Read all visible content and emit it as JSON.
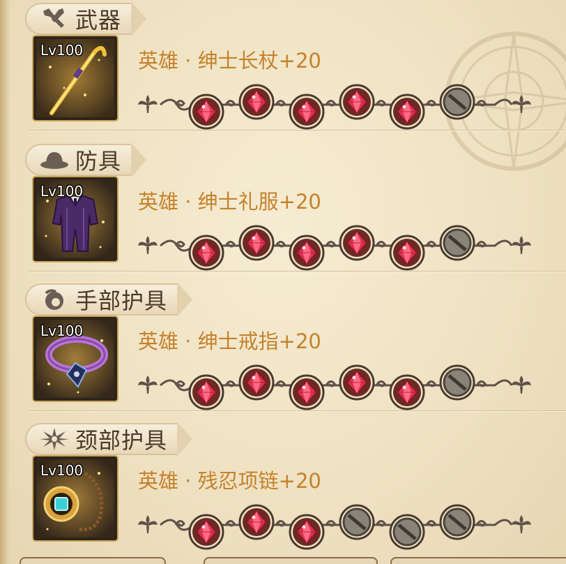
{
  "sections": [
    {
      "category": "武器",
      "category_icon": "sword-icon",
      "level": "Lv100",
      "item_name": "英雄 · 绅士长杖+20",
      "item_icon": "golden-cane-icon",
      "sockets": [
        "filled",
        "filled",
        "filled",
        "filled",
        "filled",
        "empty"
      ]
    },
    {
      "category": "防具",
      "category_icon": "hat-icon",
      "level": "Lv100",
      "item_name": "英雄 · 绅士礼服+20",
      "item_icon": "suit-armor-icon",
      "sockets": [
        "filled",
        "filled",
        "filled",
        "filled",
        "filled",
        "empty"
      ]
    },
    {
      "category": "手部护具",
      "category_icon": "glove-icon",
      "level": "Lv100",
      "item_name": "英雄 · 绅士戒指+20",
      "item_icon": "ring-icon",
      "sockets": [
        "filled",
        "filled",
        "filled",
        "filled",
        "filled",
        "empty"
      ]
    },
    {
      "category": "颈部护具",
      "category_icon": "star-emblem-icon",
      "level": "Lv100",
      "item_name": "英雄 · 残忍项链+20",
      "item_icon": "necklace-icon",
      "sockets": [
        "filled",
        "filled",
        "filled",
        "empty",
        "empty",
        "empty"
      ]
    }
  ],
  "colors": {
    "item_name": "#c4822c",
    "gem_red": "#e0304e",
    "gem_socket": "#6b2a25",
    "empty_socket": "#8a8478"
  }
}
